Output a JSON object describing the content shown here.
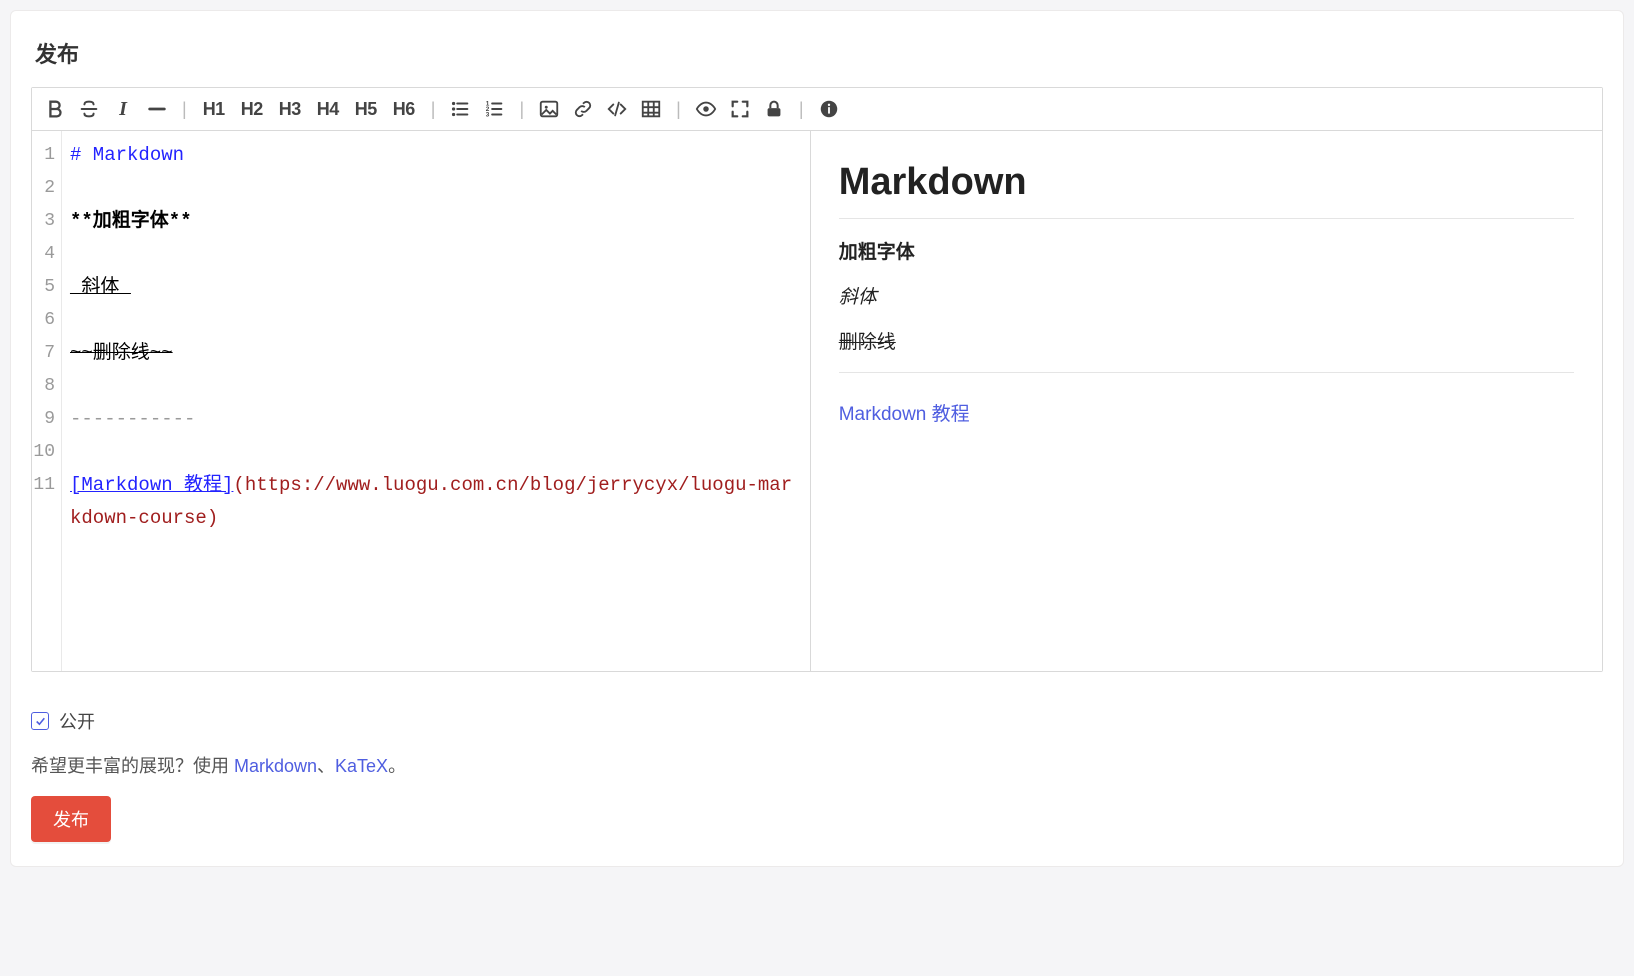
{
  "page_title": "发布",
  "toolbar": {
    "h1": "H1",
    "h2": "H2",
    "h3": "H3",
    "h4": "H4",
    "h5": "H5",
    "h6": "H6"
  },
  "source": {
    "lines": [
      {
        "no": "1",
        "kind": "header",
        "text": "# Markdown"
      },
      {
        "no": "2",
        "kind": "blank",
        "text": ""
      },
      {
        "no": "3",
        "kind": "strong",
        "text": "**加粗字体**"
      },
      {
        "no": "4",
        "kind": "blank",
        "text": ""
      },
      {
        "no": "5",
        "kind": "em",
        "text": "_斜体_"
      },
      {
        "no": "6",
        "kind": "blank",
        "text": ""
      },
      {
        "no": "7",
        "kind": "strike",
        "text": "~~删除线~~"
      },
      {
        "no": "8",
        "kind": "blank",
        "text": ""
      },
      {
        "no": "9",
        "kind": "hr",
        "text": "-----------"
      },
      {
        "no": "10",
        "kind": "blank",
        "text": ""
      },
      {
        "no": "11",
        "kind": "link",
        "link_text": "[Markdown 教程]",
        "link_url": "(https://www.luogu.com.cn/blog/jerrycyx/luogu-markdown-course)"
      }
    ]
  },
  "preview": {
    "h1": "Markdown",
    "bold": "加粗字体",
    "italic": "斜体",
    "strike": "删除线",
    "link_text": "Markdown 教程"
  },
  "footer": {
    "public_label": "公开",
    "public_checked": true,
    "help_prefix": "希望更丰富的展现？使用 ",
    "help_link_1": "Markdown",
    "help_sep": "、",
    "help_link_2": "KaTeX",
    "help_suffix": "。",
    "publish_label": "发布"
  }
}
